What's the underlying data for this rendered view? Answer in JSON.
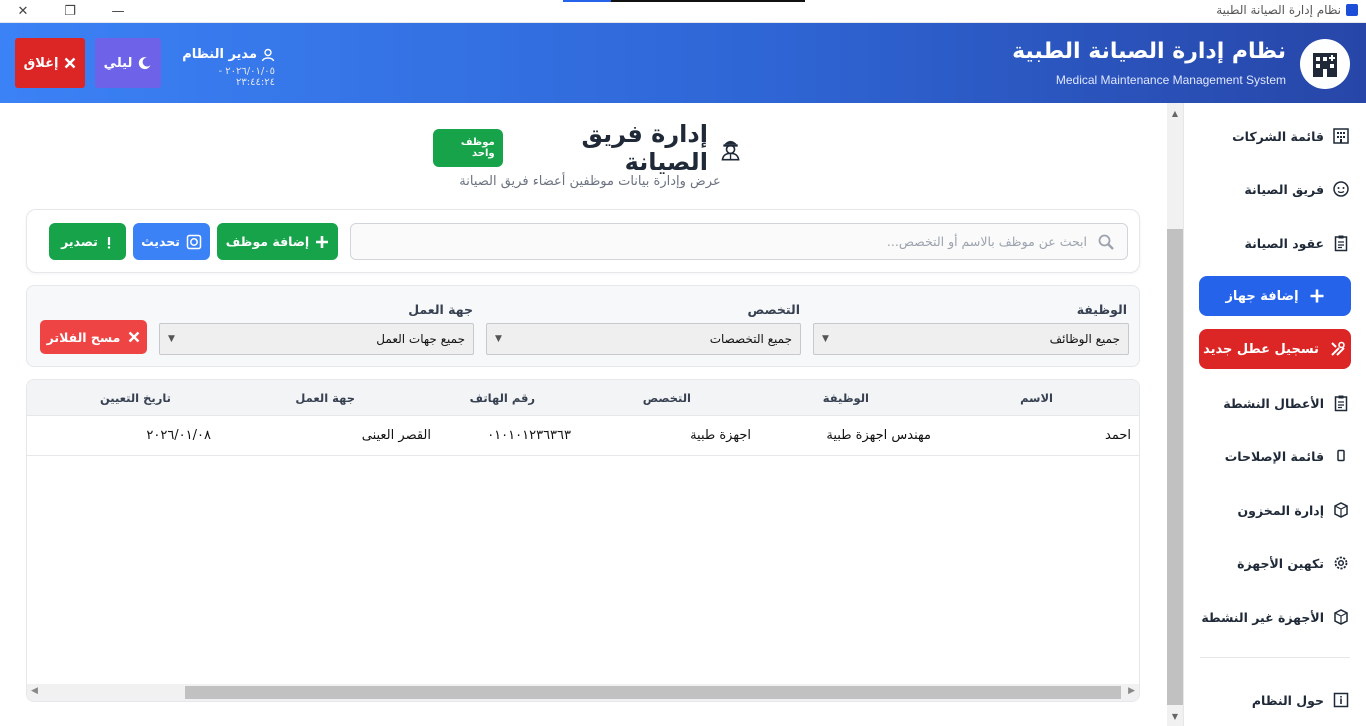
{
  "window": {
    "title": "نظام إدارة الصيانة الطبية",
    "controls": {
      "close": "✕",
      "maximize": "❐",
      "minimize": "—"
    }
  },
  "header": {
    "title": "نظام إدارة الصيانة الطبية",
    "subtitle": "Medical Maintenance Management System",
    "user_name": "مدير النظام",
    "datetime": "٢٠٢٦/٠١/٠٥ - ٢٣:٤٤:٢٤",
    "night_label": "ليلي",
    "close_label": "إغلاق",
    "colors": {
      "gradient_start": "#3b82f6",
      "gradient_end": "#2746a8",
      "close": "#dc2626",
      "night": "#6d62e8"
    }
  },
  "sidebar": {
    "items": [
      {
        "label": "قائمة الشركات",
        "icon": "building-icon"
      },
      {
        "label": "فريق الصيانة",
        "icon": "worker-icon"
      },
      {
        "label": "عقود الصيانة",
        "icon": "clipboard-icon"
      },
      {
        "label": "الأعطال النشطة",
        "icon": "clipboard-icon"
      },
      {
        "label": "قائمة الإصلاحات",
        "icon": "phone-icon"
      },
      {
        "label": "إدارة المخزون",
        "icon": "box-icon"
      },
      {
        "label": "تكهين الأجهزة",
        "icon": "gear-icon"
      },
      {
        "label": "الأجهزة غير النشطة",
        "icon": "box-icon"
      },
      {
        "label": "حول النظام",
        "icon": "info-icon"
      }
    ],
    "add_device_label": "إضافة جهاز",
    "new_fault_label": "تسجيل عطل جديد"
  },
  "main": {
    "title": "إدارة فريق الصيانة",
    "count_badge": "موظف واحد",
    "subtitle": "عرض وإدارة بيانات موظفين أعضاء فريق الصيانة",
    "search_placeholder": "ابحث عن موظف بالاسم أو التخصص...",
    "add_employee_label": "إضافة موظف",
    "refresh_label": "تحديث",
    "export_label": "تصدير",
    "filters": {
      "job_label": "الوظيفة",
      "job_value": "جميع الوظائف",
      "specialty_label": "التخصص",
      "specialty_value": "جميع التخصصات",
      "workplace_label": "جهة العمل",
      "workplace_value": "جميع جهات العمل",
      "clear_label": "مسح الفلاتر"
    },
    "table": {
      "headers": [
        "الاسم",
        "الوظيفة",
        "التخصص",
        "رقم الهاتف",
        "جهة العمل",
        "تاريخ التعيين"
      ],
      "rows": [
        [
          "احمد",
          "مهندس اجهزة طبية",
          "اجهزة طبية",
          "٠١٠١٠١٢٣٦٣٦٣",
          "القصر العينى",
          "٢٠٢٦/٠١/٠٨"
        ]
      ]
    }
  }
}
